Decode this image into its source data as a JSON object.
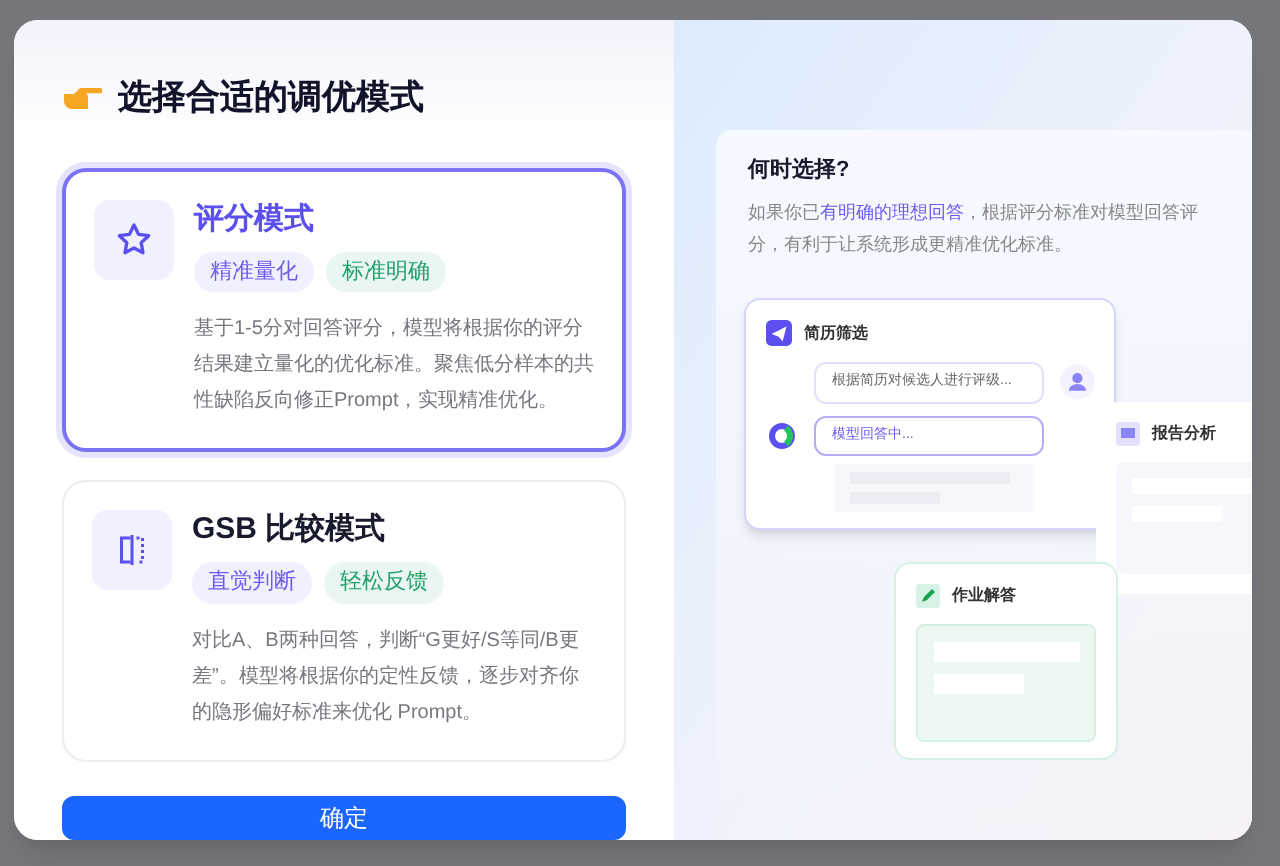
{
  "title": "选择合适的调优模式",
  "modes": [
    {
      "kind": "star",
      "title": "评分模式",
      "selected": true,
      "tags": [
        {
          "label": "精准量化",
          "color": "#6b5cf0"
        },
        {
          "label": "标准明确",
          "color": "#22a06b"
        }
      ],
      "description": "基于1-5分对回答评分，模型将根据你的评分结果建立量化的优化标准。聚焦低分样本的共性缺陷反向修正Prompt，实现精准优化。"
    },
    {
      "kind": "compare",
      "title": "GSB 比较模式",
      "selected": false,
      "tags": [
        {
          "label": "直觉判断",
          "color": "#6b5cf0"
        },
        {
          "label": "轻松反馈",
          "color": "#22a06b"
        }
      ],
      "description": "对比A、B两种回答，判断“G更好/S等同/B更差”。模型将根据你的定性反馈，逐步对齐你的隐形偏好标准来优化 Prompt。"
    }
  ],
  "confirm_button": "确定",
  "help": {
    "title": "何时选择?",
    "text_before": "如果你已",
    "highlight": "有明确的理想回答",
    "text_after": "，根据评分标准对模型回答评分，有利于让系统形成更精准优化标准。"
  },
  "examples": [
    {
      "kind": "chat",
      "title": "简历筛选",
      "prompt": "根据简历对候选人进行评级...",
      "reply": "模型回答中..."
    },
    {
      "kind": "report",
      "title": "报告分析"
    },
    {
      "kind": "homework",
      "title": "作业解答"
    }
  ]
}
